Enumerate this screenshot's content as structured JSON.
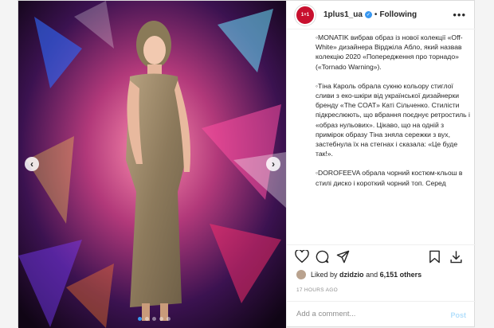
{
  "post": {
    "username": "1plus1_ua",
    "verified_mark": "✓",
    "separator": "•",
    "follow_status": "Following",
    "avatar_text": "1+1",
    "caption_paragraphs": [
      "◦MONATIK вибрав образ із нової колекції «Off-White» дизайнера Вірджіла Абло, який назвав колекцію 2020 «Попередження про торнадо» («Tornado Warning»).",
      "◦Тіна Кароль обрала сукню кольору стиглої сливи з еко-шкіри від української дизайнерки бренду «The COAT» Каті Сільченко. Стилісти підкреслюють, що вбрання поєднує ретростиль і «образ нульових». Цікаво, що на одній з примірок образу Тіна зняла сережки з вух, застебнула їх на стегнах і сказала: «Це буде так!».",
      "◦DOROFEEVA обрала чорний костюм-кльош в стилі диско і короткий чорний топ. Серед"
    ],
    "likes_prefix": "Liked by",
    "likes_user": "dzidzio",
    "likes_and": "and",
    "likes_count": "6,151 others",
    "timestamp": "17 HOURS AGO",
    "comment_placeholder": "Add a comment...",
    "post_button": "Post"
  },
  "carousel": {
    "slide_count": 5,
    "active_index": 0,
    "prev_glyph": "‹",
    "next_glyph": "›"
  },
  "icons": [
    "heart-icon",
    "comment-icon",
    "share-icon",
    "bookmark-icon",
    "download-icon",
    "more-options-icon"
  ],
  "colors": {
    "accent": "#3897f0",
    "brand": "#c8102e",
    "post_disabled": "#b2dffc"
  }
}
